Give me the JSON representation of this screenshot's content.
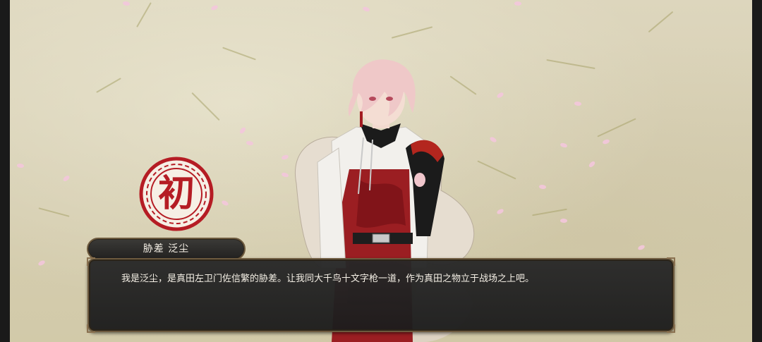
{
  "seal": {
    "glyph": "初",
    "color": "#b51c24"
  },
  "speaker": {
    "name": "胁差 泛尘"
  },
  "dialogue": {
    "text": "我是泛尘，是真田左卫门佐信繁的胁差。让我同大千鸟十文字枪一道，作为真田之物立于战场之上吧。"
  },
  "colors": {
    "paper": "#d8d0b5",
    "petal": "#f3c6dc",
    "frame": "#6d5a3e",
    "dialogue_bg": "#262626",
    "text": "#f5f0e6"
  }
}
